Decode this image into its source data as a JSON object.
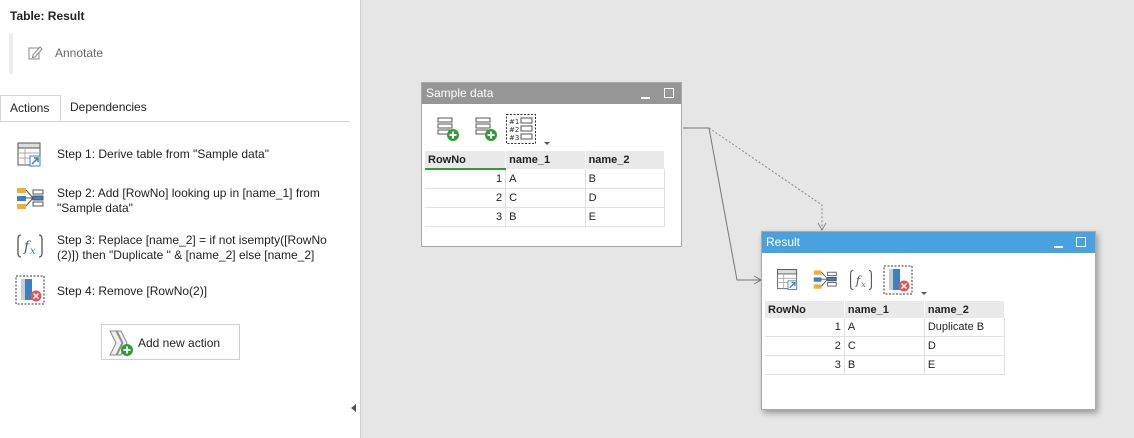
{
  "panel": {
    "title": "Table: Result",
    "annotate_label": "Annotate",
    "tabs": [
      {
        "label": "Actions",
        "active": true
      },
      {
        "label": "Dependencies",
        "active": false
      }
    ],
    "steps": [
      {
        "icon": "derive-table-icon",
        "text": "Step 1: Derive table from \"Sample data\""
      },
      {
        "icon": "lookup-icon",
        "text": "Step 2: Add [RowNo] looking up in [name_1] from \"Sample data\""
      },
      {
        "icon": "function-icon",
        "text": "Step 3: Replace [name_2] = if not isempty([RowNo (2)]) then \"Duplicate \" & [name_2] else [name_2]"
      },
      {
        "icon": "remove-column-icon",
        "text": "Step 4: Remove [RowNo(2)]"
      }
    ],
    "add_action_label": "Add new action"
  },
  "sample_window": {
    "title": "Sample data",
    "columns": [
      "RowNo",
      "name_1",
      "name_2"
    ],
    "rows": [
      [
        "1",
        "A",
        "B"
      ],
      [
        "2",
        "C",
        "D"
      ],
      [
        "3",
        "B",
        "E"
      ]
    ],
    "toolbar_icon_text": [
      "#1",
      "#2",
      "#3"
    ]
  },
  "result_window": {
    "title": "Result",
    "columns": [
      "RowNo",
      "name_1",
      "name_2"
    ],
    "rows": [
      [
        "1",
        "A",
        "Duplicate B"
      ],
      [
        "2",
        "C",
        "D"
      ],
      [
        "3",
        "B",
        "E"
      ]
    ]
  },
  "colors": {
    "result_titlebar": "#4aa1df",
    "sample_titlebar": "#969696",
    "canvas": "#e6e6e6",
    "accent_green": "#2e9e3a",
    "remove_red": "#e05555"
  }
}
